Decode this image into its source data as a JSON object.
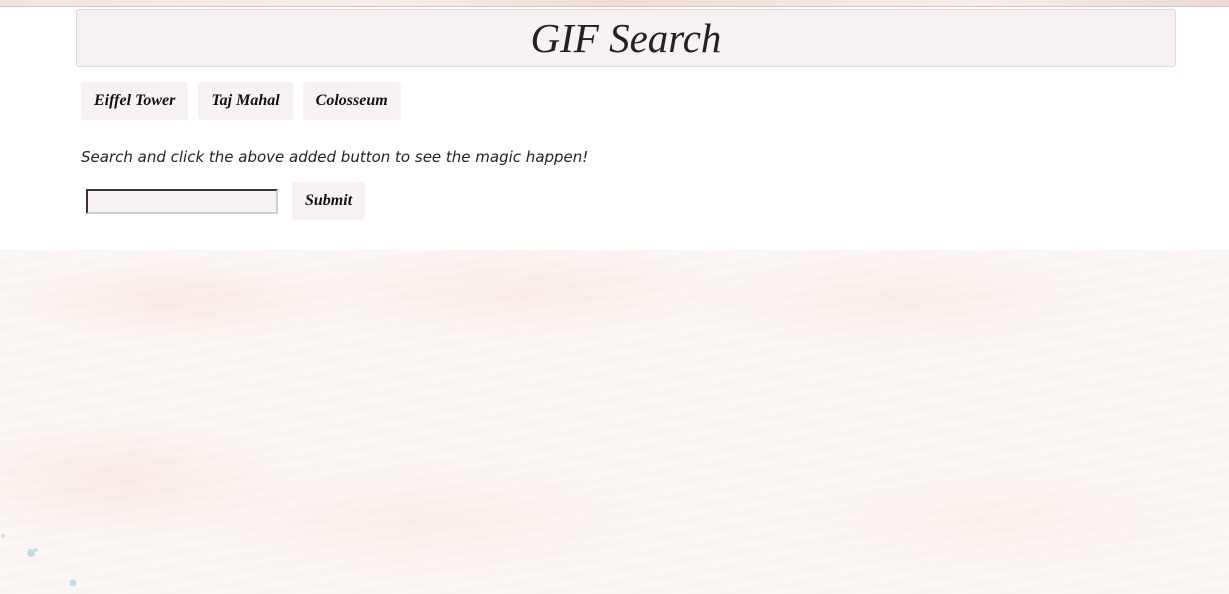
{
  "header": {
    "title": "GIF Search"
  },
  "topics": [
    {
      "label": "Eiffel Tower"
    },
    {
      "label": "Taj Mahal"
    },
    {
      "label": "Colosseum"
    }
  ],
  "hint": "Search and click the above added button to see the magic happen!",
  "search": {
    "value": "",
    "placeholder": "",
    "submit_label": "Submit"
  },
  "colors": {
    "panel_bg": "#f8f1f1",
    "page_bg": "#fcf8f6"
  }
}
